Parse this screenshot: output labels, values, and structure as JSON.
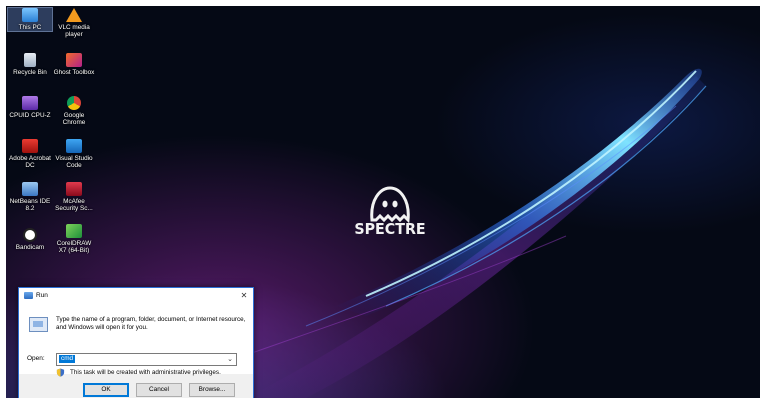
{
  "desktop": {
    "icons": [
      {
        "label": "This PC",
        "icon": "computer-icon",
        "color": "#4aa3f0"
      },
      {
        "label": "VLC media player",
        "icon": "vlc-icon",
        "color": "#f39a1e"
      },
      {
        "label": "Recycle Bin",
        "icon": "recycle-bin-icon",
        "color": "#cfd8e3"
      },
      {
        "label": "Ghost Toolbox",
        "icon": "ghost-toolbox-icon",
        "color": "#e85a2a"
      },
      {
        "label": "CPUID CPU-Z",
        "icon": "cpu-z-icon",
        "color": "#8a4fd6"
      },
      {
        "label": "Google Chrome",
        "icon": "chrome-icon",
        "color": "#f4c20d"
      },
      {
        "label": "Adobe Acrobat DC",
        "icon": "acrobat-icon",
        "color": "#d4201a"
      },
      {
        "label": "Visual Studio Code",
        "icon": "vscode-icon",
        "color": "#2d8fe0"
      },
      {
        "label": "NetBeans IDE 8.2",
        "icon": "netbeans-icon",
        "color": "#5b9bd5"
      },
      {
        "label": "McAfee Security Sc...",
        "icon": "mcafee-icon",
        "color": "#c8102e"
      },
      {
        "label": "Bandicam",
        "icon": "bandicam-icon",
        "color": "#e33a3a"
      },
      {
        "label": "CorelDRAW X7 (64-Bit)",
        "icon": "coreldraw-icon",
        "color": "#3bb54a"
      }
    ],
    "logo_text": "SPECTRE"
  },
  "run_dialog": {
    "title": "Run",
    "close_glyph": "✕",
    "description": "Type the name of a program, folder, document, or Internet resource, and Windows will open it for you.",
    "open_label": "Open:",
    "open_value": "cmd",
    "dropdown_glyph": "⌄",
    "admin_note": "This task will be created with administrative privileges.",
    "buttons": {
      "ok": "OK",
      "cancel": "Cancel",
      "browse": "Browse..."
    }
  }
}
